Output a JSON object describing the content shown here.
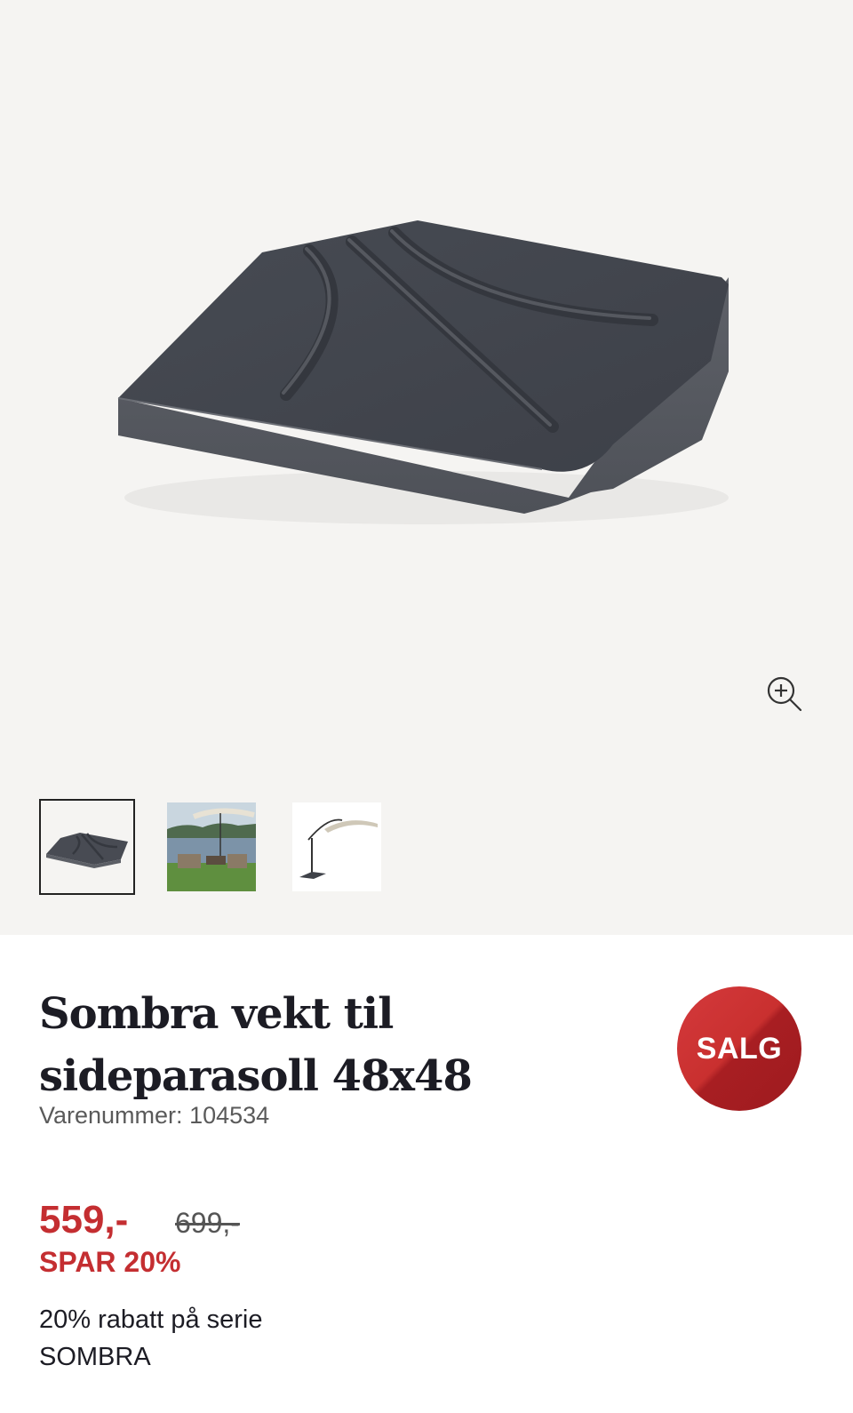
{
  "gallery": {
    "zoom_icon": "zoom-in-icon",
    "thumbnails": [
      {
        "name": "thumbnail-umbrella-base",
        "selected": true
      },
      {
        "name": "thumbnail-lake-terrace",
        "selected": false
      },
      {
        "name": "thumbnail-umbrella-with-base",
        "selected": false
      }
    ]
  },
  "product": {
    "title": "Sombra vekt til sideparasoll 48x48",
    "sku_label": "Varenummer:",
    "sku_value": "104534",
    "sale_badge": "SALG",
    "price_now": "559,-",
    "price_old": "699,-",
    "save_text": "SPAR 20%",
    "promo_text": "20% rabatt på serie SOMBRA"
  },
  "colors": {
    "accent_red": "#c42e31",
    "gallery_bg": "#f5f4f2",
    "text_dark": "#1c1c24"
  }
}
